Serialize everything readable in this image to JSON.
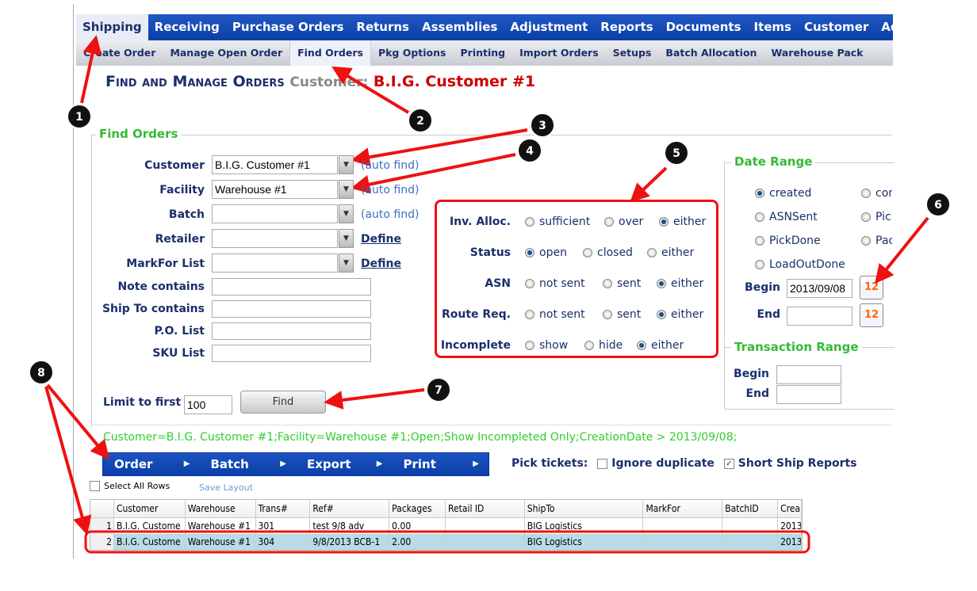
{
  "topnav": [
    "Shipping",
    "Receiving",
    "Purchase Orders",
    "Returns",
    "Assemblies",
    "Adjustment",
    "Reports",
    "Documents",
    "Items",
    "Customer",
    "Adm"
  ],
  "subnav": [
    "Create Order",
    "Manage Open Order",
    "Find Orders",
    "Pkg Options",
    "Printing",
    "Import Orders",
    "Setups",
    "Batch Allocation",
    "Warehouse Pack"
  ],
  "title": {
    "main": "Find and Manage Orders",
    "customer_label": "Customer:",
    "customer": "B.I.G. Customer #1"
  },
  "find": {
    "legend": "Find Orders",
    "selects": [
      {
        "label": "Customer",
        "value": "B.I.G. Customer #1",
        "link": "(auto find)"
      },
      {
        "label": "Facility",
        "value": "Warehouse #1",
        "link": "(auto find)"
      },
      {
        "label": "Batch",
        "value": "",
        "link": "(auto find)"
      },
      {
        "label": "Retailer",
        "value": "",
        "link": "Define"
      },
      {
        "label": "MarkFor List",
        "value": "",
        "link": "Define"
      }
    ],
    "texts": [
      {
        "label": "Note contains",
        "value": ""
      },
      {
        "label": "Ship To contains",
        "value": ""
      },
      {
        "label": "P.O. List",
        "value": ""
      },
      {
        "label": "SKU List",
        "value": ""
      }
    ],
    "limit_label": "Limit to first",
    "limit_value": "100",
    "find_button": "Find"
  },
  "radios": [
    {
      "label": "Inv. Alloc.",
      "options": [
        "sufficient",
        "over",
        "either"
      ],
      "selected": 2
    },
    {
      "label": "Status",
      "options": [
        "open",
        "closed",
        "either"
      ],
      "selected": 0
    },
    {
      "label": "ASN",
      "options": [
        "not sent",
        "sent",
        "either"
      ],
      "selected": 2
    },
    {
      "label": "Route Req.",
      "options": [
        "not sent",
        "sent",
        "either"
      ],
      "selected": 2
    },
    {
      "label": "Incomplete",
      "options": [
        "show",
        "hide",
        "either"
      ],
      "selected": 2
    }
  ],
  "date_range": {
    "legend": "Date Range",
    "options": [
      "created",
      "con",
      "ASNSent",
      "Pick",
      "PickDone",
      "Pac",
      "LoadOutDone"
    ],
    "selected": 0,
    "begin_label": "Begin",
    "begin_value": "2013/09/08",
    "end_label": "End",
    "end_value": "",
    "calendar_num": "12"
  },
  "trans_range": {
    "legend": "Transaction Range",
    "begin_label": "Begin",
    "end_label": "End"
  },
  "filter_text": "Customer=B.I.G. Customer #1;Facility=Warehouse #1;Open;Show Incompleted Only;CreationDate > 2013/09/08;",
  "toolbar": [
    "Order",
    "Batch",
    "Export",
    "Print"
  ],
  "pick": {
    "label": "Pick tickets:",
    "ignore": "Ignore duplicate",
    "ignore_checked": false,
    "short": "Short Ship Reports",
    "short_checked": true
  },
  "select_all": "Select All Rows",
  "save_layout": "Save Layout",
  "grid": {
    "columns": [
      "",
      "Customer",
      "Warehouse",
      "Trans#",
      "Ref#",
      "Packages",
      "Retail ID",
      "ShipTo",
      "MarkFor",
      "BatchID",
      "Crea"
    ],
    "rows": [
      [
        "1",
        "B.I.G. Custome",
        "Warehouse #1",
        "301",
        "test 9/8 adv",
        "0.00",
        "",
        "BIG Logistics",
        "",
        "",
        "2013"
      ],
      [
        "2",
        "B.I.G. Custome",
        "Warehouse #1",
        "304",
        "9/8/2013 BCB-1",
        "2.00",
        "",
        "BIG Logistics",
        "",
        "",
        "2013"
      ]
    ],
    "selected_row": 1
  },
  "annotations": [
    "1",
    "2",
    "3",
    "4",
    "5",
    "6",
    "7",
    "8"
  ],
  "colors": {
    "nav": "#0a3fa8",
    "legend": "#33bb33",
    "customer": "#cc0000",
    "annotation": "#ee1111"
  }
}
